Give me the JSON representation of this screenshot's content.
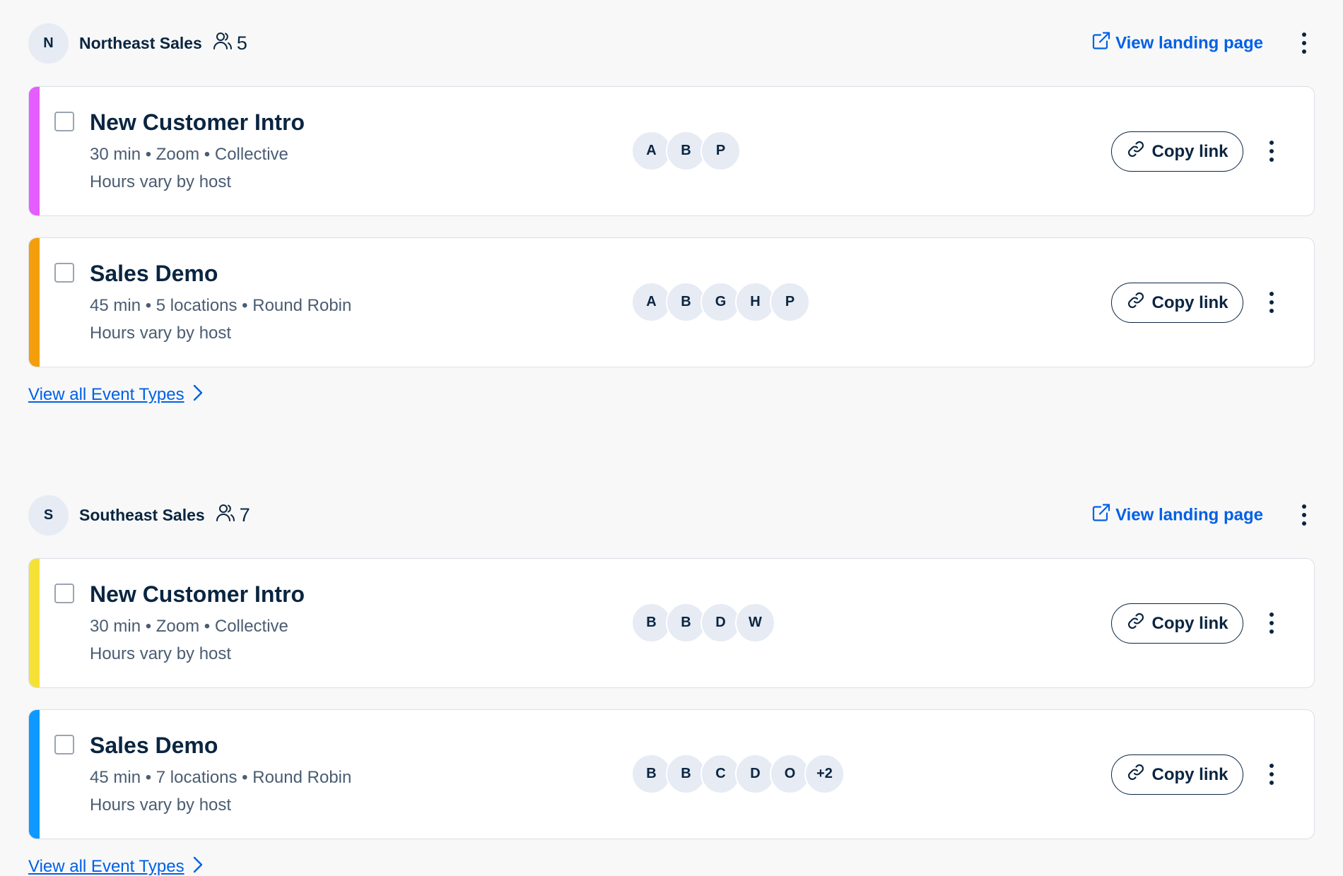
{
  "teams": [
    {
      "initial": "N",
      "name": "Northeast Sales",
      "member_count": "5",
      "landing_label": "View landing page",
      "view_all_label": "View all Event Types",
      "events": [
        {
          "title": "New Customer Intro",
          "meta": "30 min • Zoom • Collective",
          "hours": "Hours vary by host",
          "color": "#e55cff",
          "hosts": [
            "A",
            "B",
            "P"
          ],
          "copy_label": "Copy link"
        },
        {
          "title": "Sales Demo",
          "meta": "45 min • 5 locations • Round Robin",
          "hours": "Hours vary by host",
          "color": "#f59e0b",
          "hosts": [
            "A",
            "B",
            "G",
            "H",
            "P"
          ],
          "copy_label": "Copy link"
        }
      ]
    },
    {
      "initial": "S",
      "name": "Southeast Sales",
      "member_count": "7",
      "landing_label": "View landing page",
      "view_all_label": "View all Event Types",
      "events": [
        {
          "title": "New Customer Intro",
          "meta": "30 min • Zoom • Collective",
          "hours": "Hours vary by host",
          "color": "#f5e136",
          "hosts": [
            "B",
            "B",
            "D",
            "W"
          ],
          "copy_label": "Copy link"
        },
        {
          "title": "Sales Demo",
          "meta": "45 min • 7 locations • Round Robin",
          "hours": "Hours vary by host",
          "color": "#0d99ff",
          "hosts": [
            "B",
            "B",
            "C",
            "D",
            "O",
            "+2"
          ],
          "copy_label": "Copy link"
        }
      ]
    }
  ],
  "colors": {
    "link": "#0060e6",
    "text": "#0a2540",
    "muted": "#4a5c72",
    "avatar_bg": "#e6ebf4"
  },
  "icons": {
    "members": "people-icon",
    "landing": "external-link-icon",
    "copy": "link-icon",
    "more": "kebab-icon",
    "next": "chevron-right-icon"
  }
}
